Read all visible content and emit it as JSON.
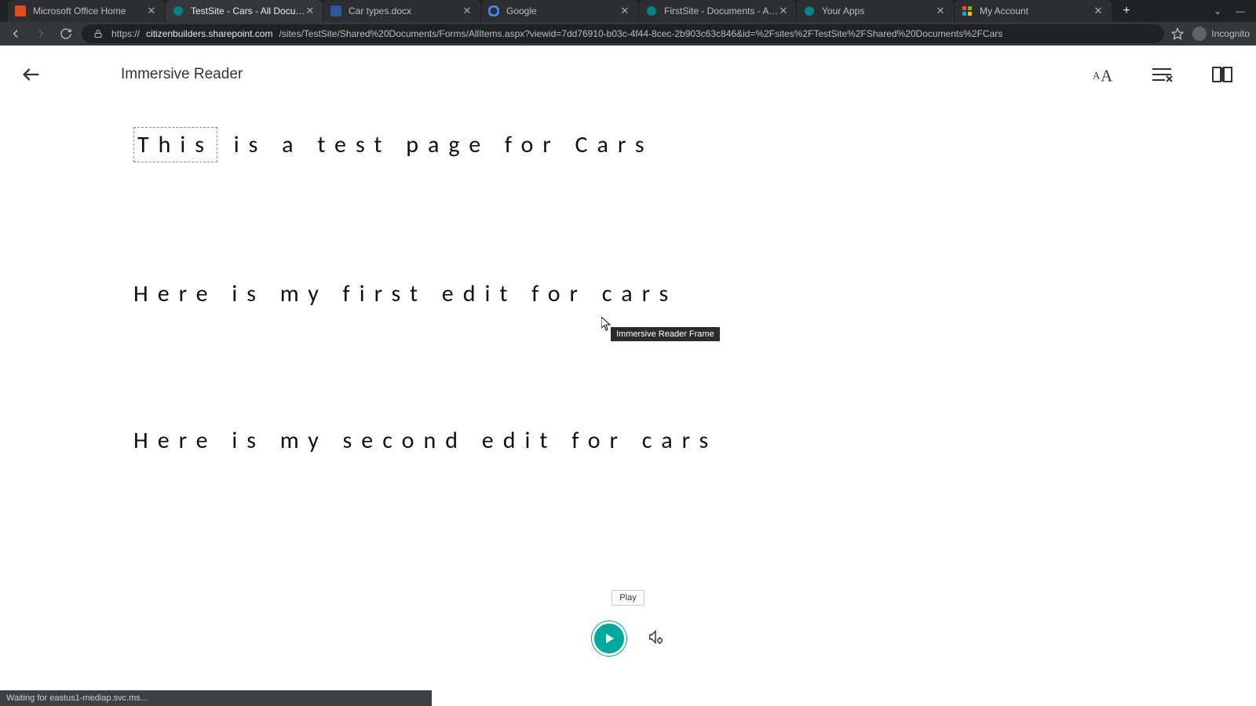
{
  "browser": {
    "url_prefix": "https://",
    "url_domain": "citizenbuilders.sharepoint.com",
    "url_path": "/sites/TestSite/Shared%20Documents/Forms/AllItems.aspx?viewid=7dd76910-b03c-4f44-8cec-2b903c63c846&id=%2Fsites%2FTestSite%2FShared%20Documents%2FCars",
    "incognito_label": "Incognito",
    "tabs": [
      {
        "title": "Microsoft Office Home",
        "favicon_color": "#e64a19"
      },
      {
        "title": "TestSite - Cars - All Documents",
        "favicon_color": "#038387"
      },
      {
        "title": "Car types.docx",
        "favicon_color": "#2b579a"
      },
      {
        "title": "Google",
        "favicon_color": "#4285f4"
      },
      {
        "title": "FirstSite - Documents - All Docu",
        "favicon_color": "#038387"
      },
      {
        "title": "Your Apps",
        "favicon_color": "#038387"
      },
      {
        "title": "My Account",
        "favicon_color": "#7fba00"
      }
    ],
    "active_tab_index": 1
  },
  "immersive_reader": {
    "header_title": "Immersive Reader",
    "play_label": "Play",
    "tooltip_text": "Immersive Reader Frame"
  },
  "document": {
    "p1_highlight": "This",
    "p1_rest": " is a test page for Cars",
    "p2": "Here is my first edit for cars",
    "p3": "Here is my second edit for cars"
  },
  "status_bar": "Waiting for eastus1-mediap.svc.ms..."
}
